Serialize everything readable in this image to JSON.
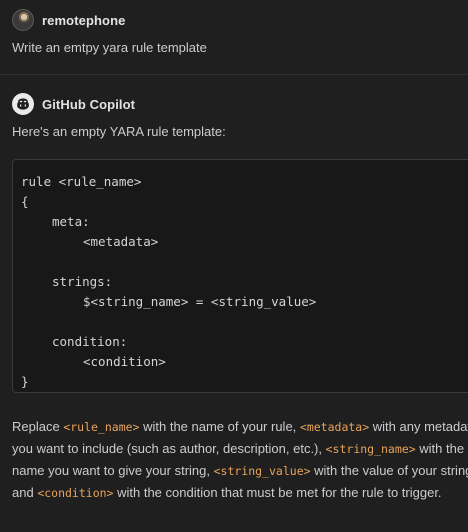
{
  "user_message": {
    "author": "remotephone",
    "text": "Write an emtpy yara rule template"
  },
  "assistant_message": {
    "author": "GitHub Copilot",
    "intro": "Here's an empty YARA rule template:",
    "code_lines": [
      "rule <rule_name>",
      "{",
      "meta:",
      "<metadata>",
      "",
      "strings:",
      "$<string_name> = <string_value>",
      "",
      "condition:",
      "<condition>",
      "}"
    ],
    "explanation": {
      "t1": "Replace ",
      "c1": "<rule_name>",
      "t2": " with the name of your rule, ",
      "c2": "<metadata>",
      "t3": " with any metadata you want to include (such as author, description, etc.), ",
      "c3": "<string_name>",
      "t4": " with the name you want to give your string, ",
      "c4": "<string_value>",
      "t5": " with the value of your string, and ",
      "c5": "<condition>",
      "t6": " with the condition that must be met for the rule to trigger."
    }
  },
  "colors": {
    "background": "#1f1f1f",
    "code_background": "#181818",
    "inline_code": "#e9a35a",
    "text": "#cccccc"
  },
  "icons": {
    "user_avatar": "user-avatar-photo",
    "copilot_avatar": "copilot-icon"
  }
}
